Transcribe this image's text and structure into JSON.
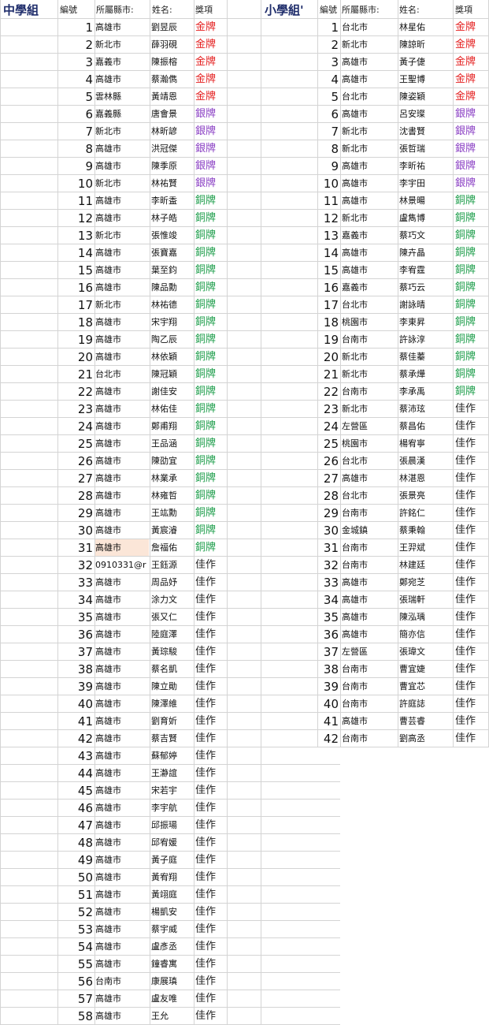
{
  "middle": {
    "title": "中學組",
    "headers": {
      "no": "編號",
      "city": "所屬縣市:",
      "name": "姓名:",
      "award": "獎項"
    },
    "rows": [
      {
        "no": "1",
        "city": "高雄市",
        "name": "劉昱辰",
        "award": "金牌",
        "cls": "gold"
      },
      {
        "no": "2",
        "city": "新北市",
        "name": "薛羽硯",
        "award": "金牌",
        "cls": "gold"
      },
      {
        "no": "3",
        "city": "嘉義市",
        "name": "陳振榕",
        "award": "金牌",
        "cls": "gold"
      },
      {
        "no": "4",
        "city": "高雄市",
        "name": "蔡瀚儁",
        "award": "金牌",
        "cls": "gold"
      },
      {
        "no": "5",
        "city": "雲林縣",
        "name": "黃靖恩",
        "award": "金牌",
        "cls": "gold"
      },
      {
        "no": "6",
        "city": "嘉義縣",
        "name": "唐會景",
        "award": "銀牌",
        "cls": "silver"
      },
      {
        "no": "7",
        "city": "新北市",
        "name": "林昕諺",
        "award": "銀牌",
        "cls": "silver"
      },
      {
        "no": "8",
        "city": "高雄市",
        "name": "洪冠傑",
        "award": "銀牌",
        "cls": "silver"
      },
      {
        "no": "9",
        "city": "高雄市",
        "name": "陳季原",
        "award": "銀牌",
        "cls": "silver"
      },
      {
        "no": "10",
        "city": "新北市",
        "name": "林祐賢",
        "award": "銀牌",
        "cls": "silver"
      },
      {
        "no": "11",
        "city": "高雄市",
        "name": "李昕盉",
        "award": "銅牌",
        "cls": "bronze"
      },
      {
        "no": "12",
        "city": "高雄市",
        "name": "林子皓",
        "award": "銅牌",
        "cls": "bronze"
      },
      {
        "no": "13",
        "city": "新北市",
        "name": "張惟竣",
        "award": "銅牌",
        "cls": "bronze"
      },
      {
        "no": "14",
        "city": "高雄市",
        "name": "張寶嘉",
        "award": "銅牌",
        "cls": "bronze"
      },
      {
        "no": "15",
        "city": "高雄市",
        "name": "葉至鈞",
        "award": "銅牌",
        "cls": "bronze"
      },
      {
        "no": "16",
        "city": "高雄市",
        "name": "陳品勳",
        "award": "銅牌",
        "cls": "bronze"
      },
      {
        "no": "17",
        "city": "新北市",
        "name": "林祐德",
        "award": "銅牌",
        "cls": "bronze"
      },
      {
        "no": "18",
        "city": "高雄市",
        "name": "宋宇翔",
        "award": "銅牌",
        "cls": "bronze"
      },
      {
        "no": "19",
        "city": "高雄市",
        "name": "陶乙辰",
        "award": "銅牌",
        "cls": "bronze"
      },
      {
        "no": "20",
        "city": "高雄市",
        "name": "林依穎",
        "award": "銅牌",
        "cls": "bronze"
      },
      {
        "no": "21",
        "city": "台北市",
        "name": "陳冠穎",
        "award": "銅牌",
        "cls": "bronze"
      },
      {
        "no": "22",
        "city": "高雄市",
        "name": "謝佳安",
        "award": "銅牌",
        "cls": "bronze"
      },
      {
        "no": "23",
        "city": "高雄市",
        "name": "林佑佳",
        "award": "銅牌",
        "cls": "bronze"
      },
      {
        "no": "24",
        "city": "高雄市",
        "name": "鄭甫翔",
        "award": "銅牌",
        "cls": "bronze"
      },
      {
        "no": "25",
        "city": "高雄市",
        "name": "王品涵",
        "award": "銅牌",
        "cls": "bronze"
      },
      {
        "no": "26",
        "city": "高雄市",
        "name": "陳劭宜",
        "award": "銅牌",
        "cls": "bronze"
      },
      {
        "no": "27",
        "city": "高雄市",
        "name": "林業承",
        "award": "銅牌",
        "cls": "bronze"
      },
      {
        "no": "28",
        "city": "高雄市",
        "name": "林雍哲",
        "award": "銅牌",
        "cls": "bronze"
      },
      {
        "no": "29",
        "city": "高雄市",
        "name": "王竑勳",
        "award": "銅牌",
        "cls": "bronze"
      },
      {
        "no": "30",
        "city": "高雄市",
        "name": "黃宸濬",
        "award": "銅牌",
        "cls": "bronze"
      },
      {
        "no": "31",
        "city": "高雄市",
        "name": "詹福佑",
        "award": "銅牌",
        "cls": "bronze",
        "hl": true
      },
      {
        "no": "32",
        "city": "0910331@r",
        "name": "王鈺源",
        "award": "佳作",
        "cls": "prize"
      },
      {
        "no": "33",
        "city": "高雄市",
        "name": "周品妤",
        "award": "佳作",
        "cls": "prize"
      },
      {
        "no": "34",
        "city": "高雄市",
        "name": "涂力文",
        "award": "佳作",
        "cls": "prize"
      },
      {
        "no": "35",
        "city": "高雄市",
        "name": "張又仁",
        "award": "佳作",
        "cls": "prize"
      },
      {
        "no": "36",
        "city": "高雄市",
        "name": "陸庭澤",
        "award": "佳作",
        "cls": "prize"
      },
      {
        "no": "37",
        "city": "高雄市",
        "name": "黃琮駿",
        "award": "佳作",
        "cls": "prize"
      },
      {
        "no": "38",
        "city": "高雄市",
        "name": "蔡名凱",
        "award": "佳作",
        "cls": "prize"
      },
      {
        "no": "39",
        "city": "高雄市",
        "name": "陳立勛",
        "award": "佳作",
        "cls": "prize"
      },
      {
        "no": "40",
        "city": "高雄市",
        "name": "陳澤維",
        "award": "佳作",
        "cls": "prize"
      },
      {
        "no": "41",
        "city": "高雄市",
        "name": "劉育妡",
        "award": "佳作",
        "cls": "prize"
      },
      {
        "no": "42",
        "city": "高雄市",
        "name": "蔡吉賢",
        "award": "佳作",
        "cls": "prize"
      },
      {
        "no": "43",
        "city": "高雄市",
        "name": "蘇郁婷",
        "award": "佳作",
        "cls": "prize"
      },
      {
        "no": "44",
        "city": "高雄市",
        "name": "王瀞誼",
        "award": "佳作",
        "cls": "prize"
      },
      {
        "no": "45",
        "city": "高雄市",
        "name": "宋若宇",
        "award": "佳作",
        "cls": "prize"
      },
      {
        "no": "46",
        "city": "高雄市",
        "name": "李宇航",
        "award": "佳作",
        "cls": "prize"
      },
      {
        "no": "47",
        "city": "高雄市",
        "name": "邱振瑒",
        "award": "佳作",
        "cls": "prize"
      },
      {
        "no": "48",
        "city": "高雄市",
        "name": "邱宥媛",
        "award": "佳作",
        "cls": "prize"
      },
      {
        "no": "49",
        "city": "高雄市",
        "name": "黃子庭",
        "award": "佳作",
        "cls": "prize"
      },
      {
        "no": "50",
        "city": "高雄市",
        "name": "黃宥翔",
        "award": "佳作",
        "cls": "prize"
      },
      {
        "no": "51",
        "city": "高雄市",
        "name": "黃翊庭",
        "award": "佳作",
        "cls": "prize"
      },
      {
        "no": "52",
        "city": "高雄市",
        "name": "楊凱安",
        "award": "佳作",
        "cls": "prize"
      },
      {
        "no": "53",
        "city": "高雄市",
        "name": "蔡宇威",
        "award": "佳作",
        "cls": "prize"
      },
      {
        "no": "54",
        "city": "高雄市",
        "name": "盧彥丞",
        "award": "佳作",
        "cls": "prize"
      },
      {
        "no": "55",
        "city": "高雄市",
        "name": "鐘睿寓",
        "award": "佳作",
        "cls": "prize"
      },
      {
        "no": "56",
        "city": "台南市",
        "name": "康展瑱",
        "award": "佳作",
        "cls": "prize"
      },
      {
        "no": "57",
        "city": "高雄市",
        "name": "盧友唯",
        "award": "佳作",
        "cls": "prize"
      },
      {
        "no": "58",
        "city": "高雄市",
        "name": "王允",
        "award": "佳作",
        "cls": "prize"
      }
    ]
  },
  "primary": {
    "title": "小學組'",
    "headers": {
      "no": "編號",
      "city": "所屬縣市:",
      "name": "姓名:",
      "award": "獎項"
    },
    "rows": [
      {
        "no": "1",
        "city": "台北市",
        "name": "林星佑",
        "award": "金牌",
        "cls": "gold"
      },
      {
        "no": "2",
        "city": "新北市",
        "name": "陳諒昕",
        "award": "金牌",
        "cls": "gold"
      },
      {
        "no": "3",
        "city": "高雄市",
        "name": "黃子倢",
        "award": "金牌",
        "cls": "gold"
      },
      {
        "no": "4",
        "city": "高雄市",
        "name": "王聖博",
        "award": "金牌",
        "cls": "gold"
      },
      {
        "no": "5",
        "city": "台北市",
        "name": "陳姿穎",
        "award": "金牌",
        "cls": "gold"
      },
      {
        "no": "6",
        "city": "高雄市",
        "name": "呂安璨",
        "award": "銀牌",
        "cls": "silver"
      },
      {
        "no": "7",
        "city": "新北市",
        "name": "沈書賢",
        "award": "銀牌",
        "cls": "silver"
      },
      {
        "no": "8",
        "city": "新北市",
        "name": "張哲瑞",
        "award": "銀牌",
        "cls": "silver"
      },
      {
        "no": "9",
        "city": "高雄市",
        "name": "李昕祐",
        "award": "銀牌",
        "cls": "silver"
      },
      {
        "no": "10",
        "city": "高雄市",
        "name": "李宇田",
        "award": "銀牌",
        "cls": "silver"
      },
      {
        "no": "11",
        "city": "高雄市",
        "name": "林景暘",
        "award": "銅牌",
        "cls": "bronze"
      },
      {
        "no": "12",
        "city": "新北市",
        "name": "盧雋博",
        "award": "銅牌",
        "cls": "bronze"
      },
      {
        "no": "13",
        "city": "嘉義市",
        "name": "蔡巧文",
        "award": "銅牌",
        "cls": "bronze"
      },
      {
        "no": "14",
        "city": "高雄市",
        "name": "陳卉晶",
        "award": "銅牌",
        "cls": "bronze"
      },
      {
        "no": "15",
        "city": "高雄市",
        "name": "李宥霆",
        "award": "銅牌",
        "cls": "bronze"
      },
      {
        "no": "16",
        "city": "嘉義市",
        "name": "蔡巧云",
        "award": "銅牌",
        "cls": "bronze"
      },
      {
        "no": "17",
        "city": "台北市",
        "name": "謝詠晴",
        "award": "銅牌",
        "cls": "bronze"
      },
      {
        "no": "18",
        "city": "桃園市",
        "name": "李東昇",
        "award": "銅牌",
        "cls": "bronze"
      },
      {
        "no": "19",
        "city": "台南市",
        "name": "許詠淳",
        "award": "銅牌",
        "cls": "bronze"
      },
      {
        "no": "20",
        "city": "新北市",
        "name": "蔡佳蓁",
        "award": "銅牌",
        "cls": "bronze"
      },
      {
        "no": "21",
        "city": "新北市",
        "name": "蔡承燁",
        "award": "銅牌",
        "cls": "bronze"
      },
      {
        "no": "22",
        "city": "台南市",
        "name": "李承禹",
        "award": "銅牌",
        "cls": "bronze"
      },
      {
        "no": "23",
        "city": "新北市",
        "name": "蔡沛玹",
        "award": "佳作",
        "cls": "prize"
      },
      {
        "no": "24",
        "city": "左營區",
        "name": "蔡昌佑",
        "award": "佳作",
        "cls": "prize"
      },
      {
        "no": "25",
        "city": "桃園市",
        "name": "楊宥寧",
        "award": "佳作",
        "cls": "prize"
      },
      {
        "no": "26",
        "city": "台北市",
        "name": "張晨漢",
        "award": "佳作",
        "cls": "prize"
      },
      {
        "no": "27",
        "city": "高雄市",
        "name": "林湛恩",
        "award": "佳作",
        "cls": "prize"
      },
      {
        "no": "28",
        "city": "台北市",
        "name": "張景亮",
        "award": "佳作",
        "cls": "prize"
      },
      {
        "no": "29",
        "city": "台南市",
        "name": "許銘仁",
        "award": "佳作",
        "cls": "prize"
      },
      {
        "no": "30",
        "city": "金城鎮",
        "name": "蔡秉翰",
        "award": "佳作",
        "cls": "prize"
      },
      {
        "no": "31",
        "city": "台南市",
        "name": "王羿斌",
        "award": "佳作",
        "cls": "prize"
      },
      {
        "no": "32",
        "city": "台南市",
        "name": "林建廷",
        "award": "佳作",
        "cls": "prize"
      },
      {
        "no": "33",
        "city": "高雄市",
        "name": "鄭宛芝",
        "award": "佳作",
        "cls": "prize"
      },
      {
        "no": "34",
        "city": "高雄市",
        "name": "張瑞軒",
        "award": "佳作",
        "cls": "prize"
      },
      {
        "no": "35",
        "city": "高雄市",
        "name": "陳泓瑀",
        "award": "佳作",
        "cls": "prize"
      },
      {
        "no": "36",
        "city": "高雄市",
        "name": "簡亦信",
        "award": "佳作",
        "cls": "prize"
      },
      {
        "no": "37",
        "city": "左營區",
        "name": "張瑋文",
        "award": "佳作",
        "cls": "prize"
      },
      {
        "no": "38",
        "city": "台南市",
        "name": "曹宜婕",
        "award": "佳作",
        "cls": "prize"
      },
      {
        "no": "39",
        "city": "台南市",
        "name": "曹宜芯",
        "award": "佳作",
        "cls": "prize"
      },
      {
        "no": "40",
        "city": "台南市",
        "name": "許庭誌",
        "award": "佳作",
        "cls": "prize"
      },
      {
        "no": "41",
        "city": "高雄市",
        "name": "曹芸睿",
        "award": "佳作",
        "cls": "prize"
      },
      {
        "no": "42",
        "city": "台南市",
        "name": "劉高丞",
        "award": "佳作",
        "cls": "prize"
      }
    ]
  }
}
